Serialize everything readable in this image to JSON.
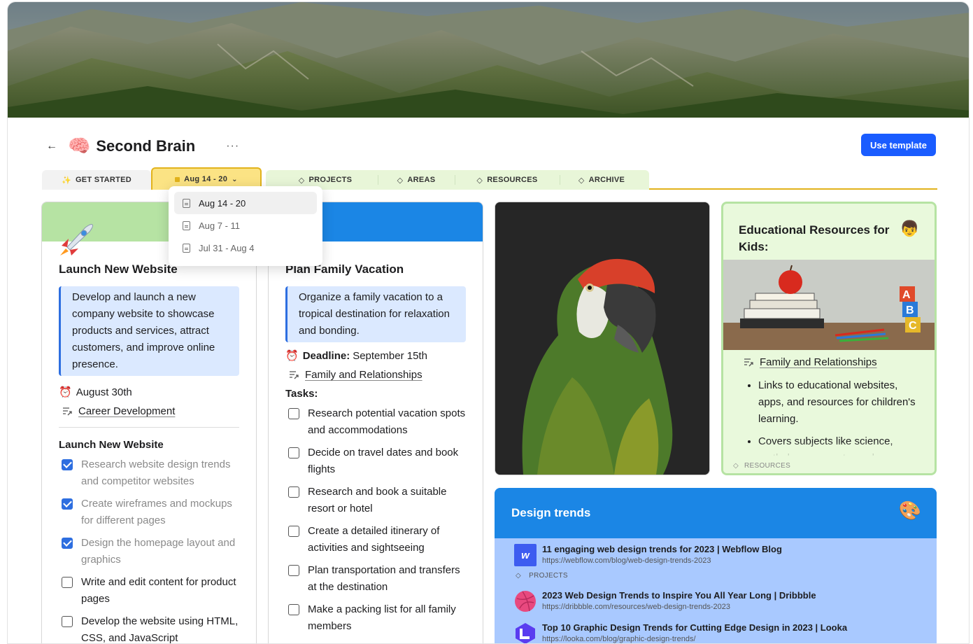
{
  "page": {
    "title": "Second Brain",
    "title_emoji": "🧠",
    "back_icon": "←",
    "more_icon": "···",
    "use_template_label": "Use template"
  },
  "tabs": {
    "get_started": {
      "icon": "✨",
      "label": "GET STARTED"
    },
    "week": {
      "label": "Aug 14 - 20",
      "chevron": "⌄"
    },
    "projects": {
      "icon": "◇",
      "label": "PROJECTS"
    },
    "areas": {
      "icon": "◇",
      "label": "AREAS"
    },
    "resources": {
      "icon": "◇",
      "label": "RESOURCES"
    },
    "archive": {
      "icon": "◇",
      "label": "ARCHIVE"
    }
  },
  "dropdown": {
    "items": [
      {
        "label": "Aug 14 - 20",
        "active": true
      },
      {
        "label": "Aug 7 - 11",
        "active": false
      },
      {
        "label": "Jul 31 - Aug 4",
        "active": false
      }
    ]
  },
  "card1": {
    "title": "Launch New Website",
    "description": "Develop and launch a new company website to showcase products and services, attract customers, and improve online presence.",
    "date_emoji": "⏰",
    "date": "August 30th",
    "area_link": "Career Development",
    "section_title": "Launch New Website",
    "todos": [
      {
        "label": "Research website design trends and competitor websites",
        "done": true
      },
      {
        "label": "Create wireframes and mockups for different pages",
        "done": true
      },
      {
        "label": "Design the homepage layout and graphics",
        "done": true
      },
      {
        "label": "Write and edit content for product pages",
        "done": false
      },
      {
        "label": "Develop the website using HTML, CSS, and JavaScript",
        "done": false
      }
    ]
  },
  "card2": {
    "title": "Plan Family Vacation",
    "description": "Organize a family vacation to a tropical destination for relaxation and bonding.",
    "deadline_emoji": "⏰",
    "deadline_label": "Deadline:",
    "deadline_value": "September 15th",
    "area_link": "Family and Relationships",
    "tasks_label": "Tasks:",
    "todos": [
      {
        "label": "Research potential vacation spots and accommodations",
        "done": false
      },
      {
        "label": "Decide on travel dates and book flights",
        "done": false
      },
      {
        "label": "Research and book a suitable resort or hotel",
        "done": false
      },
      {
        "label": "Create a detailed itinerary of activities and sightseeing",
        "done": false
      },
      {
        "label": "Plan transportation and transfers at the destination",
        "done": false
      },
      {
        "label": "Make a packing list for all family members",
        "done": false
      }
    ]
  },
  "card4": {
    "title": "Educational Resources for Kids:",
    "emoji": "👦",
    "area_link": "Family and Relationships",
    "bullets": [
      "Links to educational websites, apps, and resources for children's learning.",
      "Covers subjects like science, math, language arts, and more."
    ],
    "footer_icon": "◇",
    "footer_label": "RESOURCES"
  },
  "design_trends": {
    "title": "Design trends",
    "emoji": "🎨",
    "tag_icon": "◇",
    "tag_label": "PROJECTS",
    "bookmarks": [
      {
        "title": "11 engaging web design trends for 2023 | Webflow Blog",
        "url": "https://webflow.com/blog/web-design-trends-2023",
        "icon": "webflow-icon",
        "glyph": "w"
      },
      {
        "title": "2023 Web Design Trends to Inspire You All Year Long | Dribbble",
        "url": "https://dribbble.com/resources/web-design-trends-2023",
        "icon": "dribbble-icon"
      },
      {
        "title": "Top 10 Graphic Design Trends for Cutting Edge Design in 2023 | Looka",
        "url": "https://looka.com/blog/graphic-design-trends/",
        "icon": "looka-icon"
      }
    ]
  },
  "colors": {
    "accent": "#1a5cff",
    "tab_yellow": "#fbe384",
    "tab_green": "#e8f6d8",
    "callout": "#dbe9ff",
    "design_band": "#1b86e5"
  }
}
